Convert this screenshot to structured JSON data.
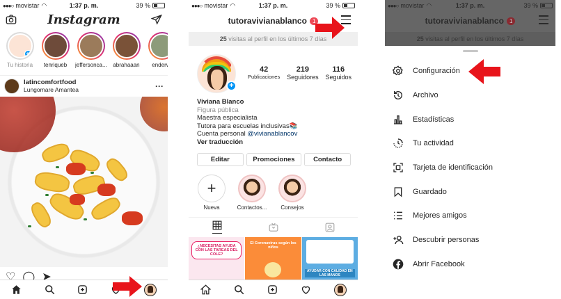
{
  "status": {
    "carrier": "movistar",
    "time": "1:37 p. m.",
    "battery": "39 %"
  },
  "feed": {
    "logo": "Instagram",
    "stories": [
      {
        "label": "Tu historia",
        "own": true
      },
      {
        "label": "tenriqueb"
      },
      {
        "label": "jeffersonca..."
      },
      {
        "label": "abrahaaan"
      },
      {
        "label": "endervy"
      }
    ],
    "post": {
      "username": "latincomfortfood",
      "subtitle": "Lungomare Amantea"
    }
  },
  "profile": {
    "username": "tutoravivianablanco",
    "notification_count": "1",
    "visits_count": "25",
    "visits_text": " visitas al perfil en los últimos 7 días",
    "stats": [
      {
        "value": "42",
        "label": "Publicaciones"
      },
      {
        "value": "219",
        "label": "Seguidores"
      },
      {
        "value": "116",
        "label": "Seguidos"
      }
    ],
    "bio": {
      "name": "Viviana Blanco",
      "category": "Figura pública",
      "line1": "Maestra especialista",
      "line2": "Tutora para escuelas inclusivas📚",
      "line3_prefix": "Cuenta personal ",
      "line3_link": "@vivianablancov",
      "translate": "Ver traducción"
    },
    "buttons": {
      "edit": "Editar",
      "promotions": "Promociones",
      "contact": "Contacto"
    },
    "highlights": [
      {
        "label": "Nueva"
      },
      {
        "label": "Contactos..."
      },
      {
        "label": "Consejos"
      }
    ],
    "thumbs": {
      "t1": "¿NECESITAS AYUDA CON LAS TAREAS DEL COLE?",
      "t2": "El Coronavirus según los niños",
      "t3": "AYUDAR CON CALIDAD EN LAS MANOS"
    }
  },
  "menu": {
    "items": [
      {
        "label": "Configuración",
        "icon": "settings-icon"
      },
      {
        "label": "Archivo",
        "icon": "archive-icon"
      },
      {
        "label": "Estadísticas",
        "icon": "insights-icon"
      },
      {
        "label": "Tu actividad",
        "icon": "activity-icon"
      },
      {
        "label": "Tarjeta de identificación",
        "icon": "nametag-icon"
      },
      {
        "label": "Guardado",
        "icon": "saved-icon"
      },
      {
        "label": "Mejores amigos",
        "icon": "close-friends-icon"
      },
      {
        "label": "Descubrir personas",
        "icon": "discover-people-icon"
      },
      {
        "label": "Abrir Facebook",
        "icon": "facebook-icon"
      }
    ]
  },
  "colors": {
    "accent_blue": "#0095f6",
    "arrow_red": "#e8141b",
    "badge_red": "#ed4956"
  }
}
